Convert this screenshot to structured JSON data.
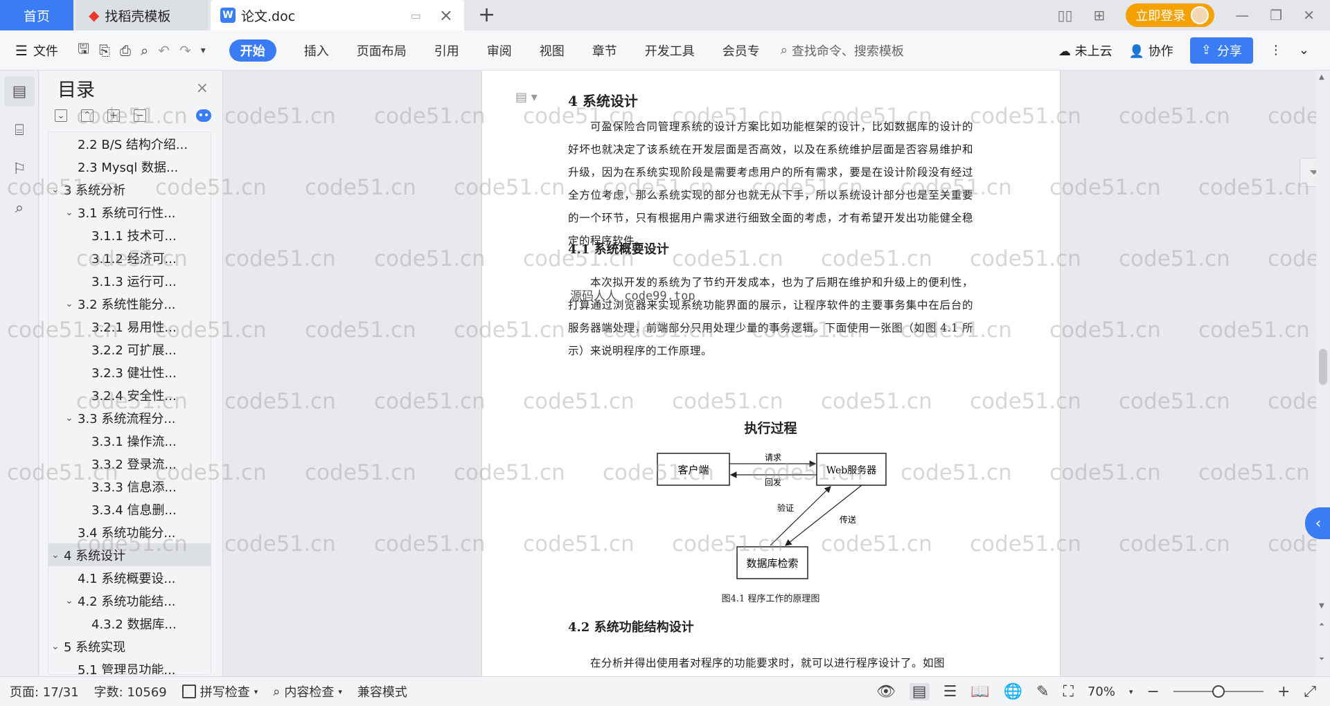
{
  "tabs": {
    "home": "首页",
    "template": "找稻壳模板",
    "doc": "论文.doc",
    "login": "立即登录"
  },
  "ribbon": {
    "file": "文件",
    "tabs": [
      "开始",
      "插入",
      "页面布局",
      "引用",
      "审阅",
      "视图",
      "章节",
      "开发工具",
      "会员专"
    ],
    "search_placeholder": "查找命令、搜索模板",
    "cloud": "未上云",
    "collab": "协作",
    "share": "分享"
  },
  "toc": {
    "title": "目录",
    "items": [
      {
        "label": "2.2 B/S 结构介绍...",
        "level": 2,
        "arrow": ""
      },
      {
        "label": "2.3 Mysql 数据...",
        "level": 2,
        "arrow": ""
      },
      {
        "label": "3  系统分析",
        "level": 1,
        "arrow": "v"
      },
      {
        "label": "3.1  系统可行性...",
        "level": 2,
        "arrow": "v"
      },
      {
        "label": "3.1.1  技术可...",
        "level": 3,
        "arrow": ""
      },
      {
        "label": "3.1.2  经济可...",
        "level": 3,
        "arrow": ""
      },
      {
        "label": "3.1.3  运行可...",
        "level": 3,
        "arrow": ""
      },
      {
        "label": "3.2  系统性能分...",
        "level": 2,
        "arrow": "v"
      },
      {
        "label": "3.2.1  易用性...",
        "level": 3,
        "arrow": ""
      },
      {
        "label": "3.2.2  可扩展...",
        "level": 3,
        "arrow": ""
      },
      {
        "label": "3.2.3  健壮性...",
        "level": 3,
        "arrow": ""
      },
      {
        "label": "3.2.4  安全性...",
        "level": 3,
        "arrow": ""
      },
      {
        "label": "3.3  系统流程分...",
        "level": 2,
        "arrow": "v"
      },
      {
        "label": "3.3.1  操作流...",
        "level": 3,
        "arrow": ""
      },
      {
        "label": "3.3.2  登录流...",
        "level": 3,
        "arrow": ""
      },
      {
        "label": "3.3.3  信息添...",
        "level": 3,
        "arrow": ""
      },
      {
        "label": "3.3.4  信息删...",
        "level": 3,
        "arrow": ""
      },
      {
        "label": "3.4  系统功能分...",
        "level": 2,
        "arrow": ""
      },
      {
        "label": "4  系统设计",
        "level": 1,
        "arrow": "v",
        "selected": true
      },
      {
        "label": "4.1  系统概要设...",
        "level": 2,
        "arrow": ""
      },
      {
        "label": "4.2  系统功能结...",
        "level": 2,
        "arrow": "v"
      },
      {
        "label": "4.3.2  数据库...",
        "level": 3,
        "arrow": ""
      },
      {
        "label": "5  系统实现",
        "level": 1,
        "arrow": "v"
      },
      {
        "label": "5.1  管理员功能...",
        "level": 2,
        "arrow": ""
      }
    ]
  },
  "doc": {
    "h1": "4  系统设计",
    "p1": "可盈保险合同管理系统的设计方案比如功能框架的设计，比如数据库的设计的好坏也就决定了该系统在开发层面是否高效，以及在系统维护层面是否容易维护和升级，因为在系统实现阶段是需要考虑用户的所有需求，要是在设计阶段没有经过全方位考虑，那么系统实现的部分也就无从下手，所以系统设计部分也是至关重要的一个环节，只有根据用户需求进行细致全面的考虑，才有希望开发出功能健全稳定的程序软件。",
    "h2a": "4.1  系统概要设计",
    "p2": "本次拟开发的系统为了节约开发成本，也为了后期在维护和升级上的便利性，打算通过浏览器来实现系统功能界面的展示，让程序软件的主要事务集中在后台的服务器端处理，前端部分只用处理少量的事务逻辑。下面使用一张图（如图 4.1 所示）来说明程序的工作原理。",
    "fig_title": "执行过程",
    "fig_caption": "图4.1  程序工作的原理图",
    "h2b": "4.2  系统功能结构设计",
    "p3": "在分析并得出使用者对程序的功能要求时，就可以进行程序设计了。如图",
    "stamp": "源码人人 code99.top",
    "watermark": "code51.cn"
  },
  "diagram": {
    "client": "客户端",
    "server": "Web服务器",
    "db": "数据库检索",
    "request": "请求",
    "reply": "回发",
    "verify": "验证",
    "transfer": "传送"
  },
  "status": {
    "page": "页面: 17/31",
    "words": "字数: 10569",
    "spell": "拼写检查",
    "content": "内容检查",
    "compat": "兼容模式",
    "zoom": "70%"
  }
}
